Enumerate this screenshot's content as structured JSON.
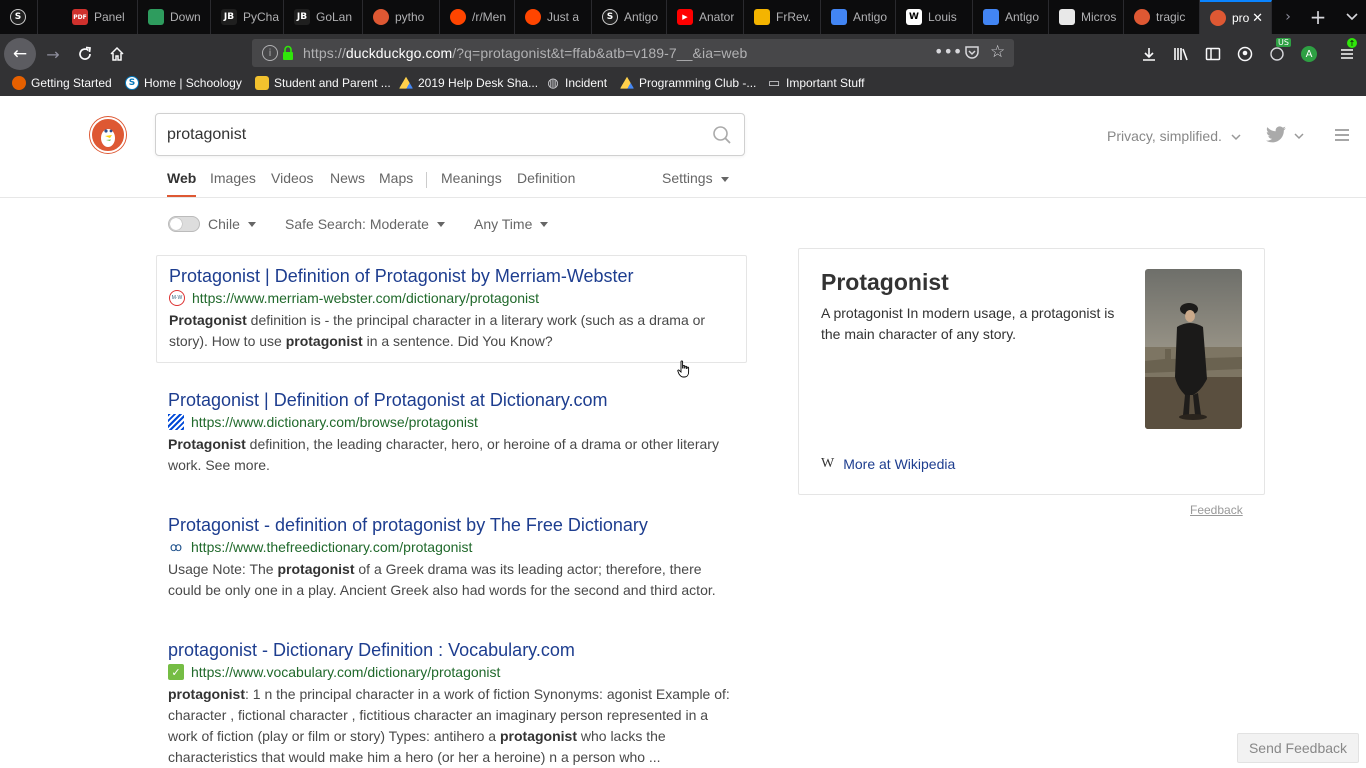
{
  "browser": {
    "tabs": [
      {
        "label": "",
        "icon": "s-app-icon",
        "color": "#1f1f1f"
      },
      {
        "label": "Panel",
        "icon": "pdf-icon",
        "color": "#d0312d"
      },
      {
        "label": "Down",
        "icon": "cloud-icon",
        "color": "#2e9c5e"
      },
      {
        "label": "PyCha",
        "icon": "jb-icon",
        "color": "#1f1f1f"
      },
      {
        "label": "GoLan",
        "icon": "jb-icon",
        "color": "#1f1f1f"
      },
      {
        "label": "pytho",
        "icon": "ddg-icon",
        "color": "#de5833"
      },
      {
        "label": "/r/Men",
        "icon": "reddit-icon",
        "color": "#ff4500"
      },
      {
        "label": "Just a",
        "icon": "reddit-icon",
        "color": "#ff4500"
      },
      {
        "label": "Antigo",
        "icon": "s-app-icon",
        "color": "#1f1f1f"
      },
      {
        "label": "Anator",
        "icon": "youtube-icon",
        "color": "#ff0000"
      },
      {
        "label": "FrRev.",
        "icon": "slides-icon",
        "color": "#f4b400"
      },
      {
        "label": "Antigo",
        "icon": "docs-icon",
        "color": "#4285f4"
      },
      {
        "label": "Louis",
        "icon": "wikipedia-icon",
        "color": "#ffffff"
      },
      {
        "label": "Antigo",
        "icon": "docs-icon",
        "color": "#4285f4"
      },
      {
        "label": "Micros",
        "icon": "blank-page-icon",
        "color": "#e8e8e8"
      },
      {
        "label": "tragic",
        "icon": "ddg-icon",
        "color": "#de5833"
      },
      {
        "label": "pro",
        "icon": "ddg-icon",
        "color": "#de5833"
      }
    ],
    "url_prefix": "https://",
    "url_host": "duckduckgo.com",
    "url_path": "/?q=protagonist&t=ffab&atb=v189-7__&ia=web",
    "bookmarks": [
      {
        "label": "Getting Started",
        "icon": "firefox-icon"
      },
      {
        "label": "Home | Schoology",
        "icon": "schoology-icon"
      },
      {
        "label": "Student and Parent ...",
        "icon": "bookmark-page-icon"
      },
      {
        "label": "2019 Help Desk Sha...",
        "icon": "drive-icon"
      },
      {
        "label": "Incident",
        "icon": "globe-icon"
      },
      {
        "label": "Programming Club -...",
        "icon": "drive-icon"
      },
      {
        "label": "Important Stuff",
        "icon": "folder-icon"
      }
    ],
    "profile_badge": "US",
    "profile_letter": "A"
  },
  "search": {
    "query": "protagonist",
    "tagline": "Privacy, simplified."
  },
  "nav": {
    "tabs": [
      "Web",
      "Images",
      "Videos",
      "News",
      "Maps",
      "Meanings",
      "Definition"
    ],
    "settings": "Settings"
  },
  "filters": {
    "region": "Chile",
    "safe_search": "Safe Search: Moderate",
    "time": "Any Time"
  },
  "results": [
    {
      "title": "Protagonist | Definition of Protagonist by Merriam-Webster",
      "url": "https://www.merriam-webster.com/dictionary/protagonist",
      "favicon": "merriam-webster-icon",
      "snippet_parts": [
        {
          "t": "Protagonist",
          "b": true
        },
        {
          "t": " definition is - the principal character in a literary work (such as a drama or story). How to use ",
          "b": false
        },
        {
          "t": "protagonist",
          "b": true
        },
        {
          "t": " in a sentence. Did You Know?",
          "b": false
        }
      ]
    },
    {
      "title": "Protagonist | Definition of Protagonist at Dictionary.com",
      "url": "https://www.dictionary.com/browse/protagonist",
      "favicon": "dictionary-com-icon",
      "snippet_parts": [
        {
          "t": "Protagonist",
          "b": true
        },
        {
          "t": " definition, the leading character, hero, or heroine of a drama or other literary work. See more.",
          "b": false
        }
      ]
    },
    {
      "title": "Protagonist - definition of protagonist by The Free Dictionary",
      "url": "https://www.thefreedictionary.com/protagonist",
      "favicon": "free-dictionary-icon",
      "snippet_parts": [
        {
          "t": "Usage Note: The ",
          "b": false
        },
        {
          "t": "protagonist",
          "b": true
        },
        {
          "t": " of a Greek drama was its leading actor; therefore, there could be only one in a play. Ancient Greek also had words for the second and third actor.",
          "b": false
        }
      ]
    },
    {
      "title": "protagonist - Dictionary Definition : Vocabulary.com",
      "url": "https://www.vocabulary.com/dictionary/protagonist",
      "favicon": "vocabulary-com-icon",
      "snippet_parts": [
        {
          "t": "protagonist",
          "b": true
        },
        {
          "t": ": 1 n the principal character in a work of fiction Synonyms: agonist Example of: character , fictional character , fictitious character an imaginary person represented in a work of fiction (play or film or story) Types: antihero a ",
          "b": false
        },
        {
          "t": "protagonist",
          "b": true
        },
        {
          "t": " who lacks the characteristics that would make him a hero (or her a heroine) n a person who ...",
          "b": false
        }
      ]
    }
  ],
  "knowledge_panel": {
    "title": "Protagonist",
    "abstract": "A protagonist In modern usage, a protagonist is the main character of any story.",
    "more_link": "More at Wikipedia",
    "feedback": "Feedback"
  },
  "send_feedback": "Send Feedback",
  "colors": {
    "accent": "#de5833",
    "link": "#1d3d8f",
    "url_green": "#20692b",
    "chrome_dark": "#0c0c0d",
    "chrome_toolbar": "#323234"
  }
}
